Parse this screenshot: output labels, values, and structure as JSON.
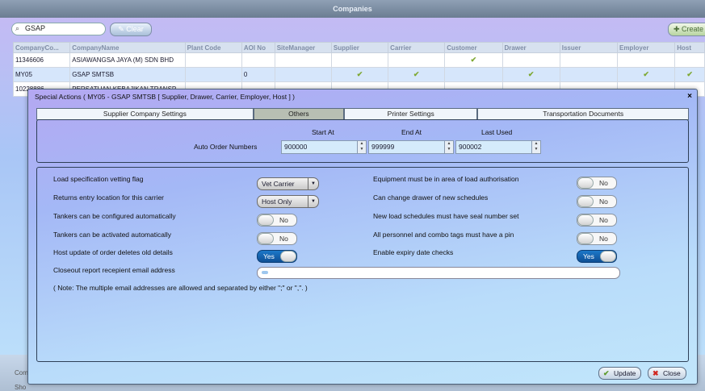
{
  "window": {
    "title": "Companies"
  },
  "toolbar": {
    "search_value": "GSAP",
    "clear_label": "Clear",
    "create_label": "Create"
  },
  "grid": {
    "columns": [
      "CompanyCo...",
      "CompanyName",
      "Plant Code",
      "AOI No",
      "SiteManager",
      "Supplier",
      "Carrier",
      "Customer",
      "Drawer",
      "Issuer",
      "Employer",
      "Host"
    ],
    "rows": [
      {
        "code": "11346606",
        "name": "ASIAWANGSA JAYA (M) SDN BHD",
        "aoi": ""
      },
      {
        "code": "MY05",
        "name": "GSAP SMTSB",
        "aoi": "0"
      },
      {
        "code": "10228886",
        "name": "PERSATUAN KEBAJIKAN TRANSP",
        "aoi": ""
      }
    ]
  },
  "dialog": {
    "title": "Special Actions ( MY05 - GSAP SMTSB [ Supplier, Drawer, Carrier, Employer, Host ] )",
    "close_glyph": "×",
    "tabs": [
      "Supplier Company Settings",
      "Others",
      "Printer Settings",
      "Transportation Documents"
    ],
    "active_tab": "Others",
    "order_numbers": {
      "label": "Auto Order Numbers",
      "start_label": "Start At",
      "end_label": "End At",
      "last_label": "Last Used",
      "start_value": "900000",
      "end_value": "999999",
      "last_value": "900002"
    },
    "settings": {
      "vetting_label": "Load specification vetting flag",
      "vetting_value": "Vet Carrier",
      "returns_label": "Returns entry location for this carrier",
      "returns_value": "Host Only",
      "tankers_config_label": "Tankers can be configured automatically",
      "tankers_config_value": "No",
      "tankers_activate_label": "Tankers can be activated automatically",
      "tankers_activate_value": "No",
      "host_update_label": "Host update of order deletes old details",
      "host_update_value": "Yes",
      "closeout_label": "Closeout report recepient email address",
      "closeout_value": "",
      "note": "( Note: The multiple email addresses are allowed and separated by either \";\" or \",\". )",
      "equipment_label": "Equipment must be in area of load authorisation",
      "equipment_value": "No",
      "drawer_label": "Can change drawer of new schedules",
      "drawer_value": "No",
      "seal_label": "New load schedules must have seal number set",
      "seal_value": "No",
      "pin_label": "All personnel and combo tags must have a pin",
      "pin_value": "No",
      "expiry_label": "Enable expiry date checks",
      "expiry_value": "Yes"
    },
    "update_label": "Update",
    "close_label": "Close"
  },
  "bottom": {
    "label1": "Com",
    "label2": "Sho"
  },
  "icons": [
    "search-icon",
    "clear-icon",
    "create-icon",
    "check-icon",
    "close-icon",
    "dropdown-arrow-icon",
    "spinner-arrows-icon"
  ],
  "colors": {
    "toggle_on": "#1d78c9",
    "check": "#7ea832",
    "titlebar": "#7b8da2"
  }
}
